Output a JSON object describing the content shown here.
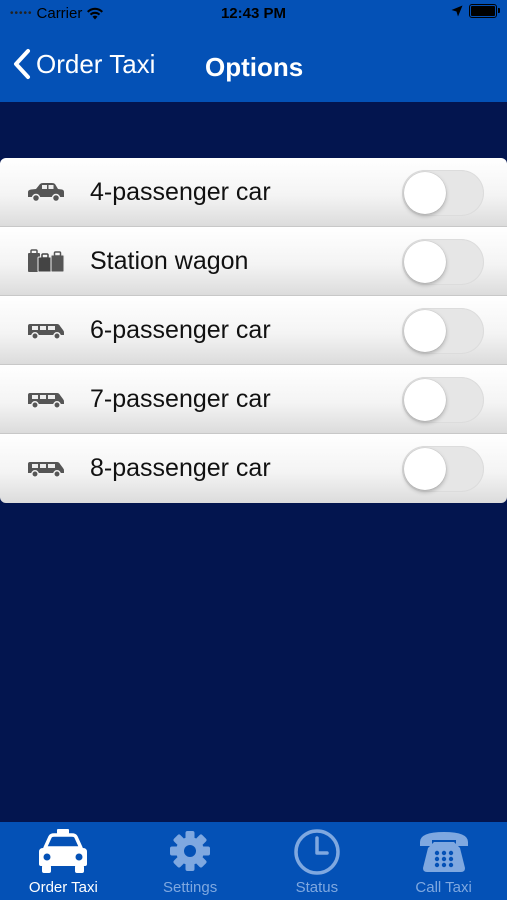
{
  "status_bar": {
    "carrier": "Carrier",
    "time": "12:43 PM"
  },
  "nav": {
    "back_label": "Order Taxi",
    "title": "Options"
  },
  "options": [
    {
      "label": "4-passenger car",
      "icon": "car-icon",
      "enabled": false
    },
    {
      "label": "Station wagon",
      "icon": "luggage-icon",
      "enabled": false
    },
    {
      "label": "6-passenger car",
      "icon": "van-icon",
      "enabled": false
    },
    {
      "label": "7-passenger car",
      "icon": "van-icon",
      "enabled": false
    },
    {
      "label": "8-passenger car",
      "icon": "van-icon",
      "enabled": false
    }
  ],
  "tabs": [
    {
      "label": "Order Taxi",
      "icon": "taxi-icon",
      "active": true
    },
    {
      "label": "Settings",
      "icon": "gear-icon",
      "active": false
    },
    {
      "label": "Status",
      "icon": "clock-icon",
      "active": false
    },
    {
      "label": "Call Taxi",
      "icon": "phone-icon",
      "active": false
    }
  ],
  "colors": {
    "nav_bar": "#0451b6",
    "background": "#03154f",
    "tab_active": "#ffffff",
    "tab_inactive": "#7fa8e0"
  }
}
